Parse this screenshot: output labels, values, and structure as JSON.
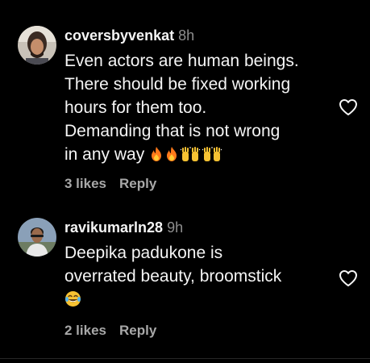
{
  "comments": [
    {
      "username": "coversbyvenkat",
      "time": "8h",
      "lines": [
        "Even actors are human beings.",
        "There should be fixed working",
        "hours for them too.",
        "Demanding that is not wrong",
        "in any way"
      ],
      "emojis": [
        "fire",
        "fire",
        "raising-hands",
        "raising-hands"
      ],
      "likes": "3 likes",
      "reply": "Reply",
      "avatar": "avatar-man-long-hair"
    },
    {
      "username": "ravikumarln28",
      "time": "9h",
      "lines": [
        "Deepika padukone is",
        "overrated beauty, broomstick"
      ],
      "emojis": [
        "face-with-tears-of-joy"
      ],
      "likes": "2 likes",
      "reply": "Reply",
      "avatar": "avatar-man-outdoor"
    }
  ],
  "icons": {
    "like": "heart-outline-icon"
  },
  "colors": {
    "background": "#000000",
    "primary_text": "#f5f5f5",
    "secondary_text": "#8e8e8e",
    "action_text": "#a8a8a8",
    "fire": "#ff7a1a",
    "raising_hands": "#f7c232"
  }
}
